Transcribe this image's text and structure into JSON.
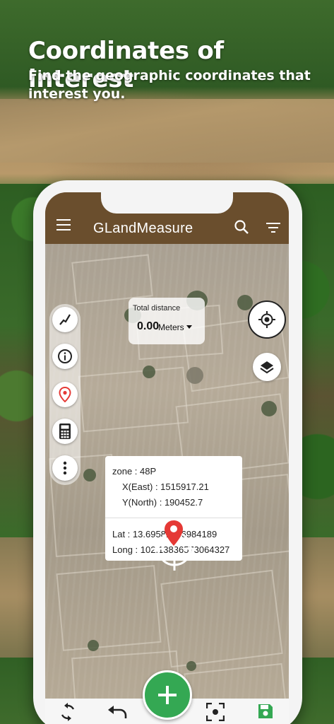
{
  "promo": {
    "headline": "Coordinates of interest",
    "subline": "Find the geographic coordinates that interest you."
  },
  "appbar": {
    "title": "GLandMeasure",
    "menu_icon": "menu-icon",
    "search_icon": "search-icon",
    "filter_icon": "filter-icon",
    "color": "#6a4e2d"
  },
  "tools": [
    {
      "name": "polyline-tool",
      "icon": "polyline-icon"
    },
    {
      "name": "info-tool",
      "icon": "info-icon"
    },
    {
      "name": "location-pin-tool",
      "icon": "location-pin-icon"
    },
    {
      "name": "calculator-tool",
      "icon": "calculator-icon"
    },
    {
      "name": "more-tool",
      "icon": "more-vertical-icon"
    }
  ],
  "distance": {
    "label": "Total distance",
    "value": "0.00",
    "unit": "Meters"
  },
  "coordinates": {
    "zone": "zone : 48P",
    "east": "X(East) : 1515917.21",
    "north": "Y(North) : 190452.7",
    "lat": "Lat : 13.69581936984189",
    "long": "Long : 102.13836573064327"
  },
  "bottom_bar": {
    "icons": [
      "rotate-icon",
      "undo-icon",
      "add-icon",
      "focus-capture-icon",
      "save-icon"
    ],
    "fab_color": "#34a853",
    "save_color": "#34a853"
  }
}
